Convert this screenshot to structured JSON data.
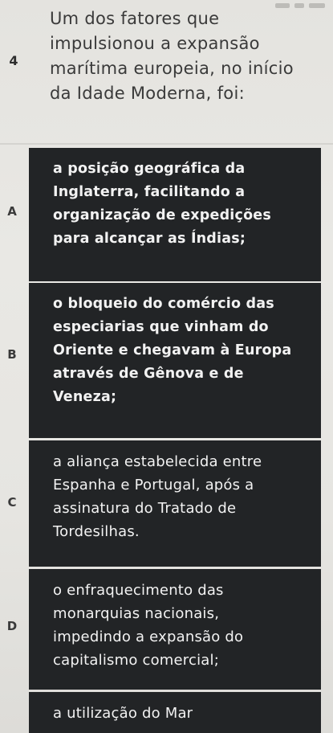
{
  "question": {
    "number": "4",
    "lines": [
      "Um dos fatores que",
      "impulsionou a expansão",
      "marítima europeia, no início",
      "da Idade Moderna, foi:"
    ]
  },
  "options": [
    {
      "letter": "A",
      "lines": [
        "a posição geográfica da",
        "Inglaterra, facilitando a",
        "organização de expedições",
        "para alcançar as Índias;"
      ]
    },
    {
      "letter": "B",
      "lines": [
        "o bloqueio do comércio das",
        "especiarias que vinham do",
        "Oriente e chegavam à Europa",
        "através de Gênova e de",
        "Veneza;"
      ]
    },
    {
      "letter": "C",
      "lines": [
        "a aliança estabelecida entre",
        "Espanha e Portugal, após a",
        "assinatura do Tratado de",
        "Tordesilhas."
      ]
    },
    {
      "letter": "D",
      "lines": [
        "o enfraquecimento das",
        "monarquias nacionais,",
        "impedindo a expansão do",
        "capitalismo comercial;"
      ]
    },
    {
      "letter": "",
      "lines": [
        "a utilização do Mar"
      ]
    }
  ]
}
